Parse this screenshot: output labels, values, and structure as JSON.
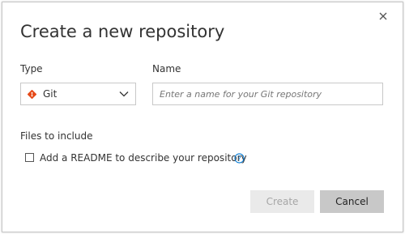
{
  "dialog": {
    "title": "Create a new repository",
    "close_icon": "close-icon"
  },
  "type_field": {
    "label": "Type",
    "selected": "Git",
    "icon": "git-icon",
    "git_color": "#e64a19"
  },
  "name_field": {
    "label": "Name",
    "value": "",
    "placeholder": "Enter a name for your Git repository"
  },
  "files_section": {
    "label": "Files to include",
    "readme_checkbox": {
      "label": "Add a README to describe your repository",
      "checked": false
    },
    "help_icon": "help-circle-icon",
    "accent_color": "#0078d4"
  },
  "footer": {
    "create_label": "Create",
    "create_enabled": false,
    "cancel_label": "Cancel"
  }
}
